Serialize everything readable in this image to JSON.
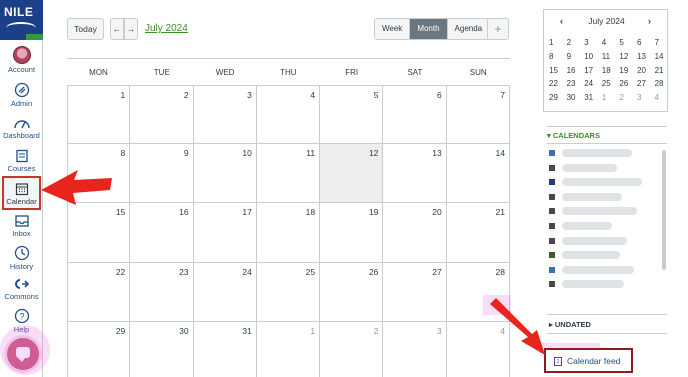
{
  "brand": {
    "logo_text": "NILE"
  },
  "global_nav": [
    {
      "key": "account",
      "label": "Account"
    },
    {
      "key": "admin",
      "label": "Admin"
    },
    {
      "key": "dashboard",
      "label": "Dashboard"
    },
    {
      "key": "courses",
      "label": "Courses"
    },
    {
      "key": "calendar",
      "label": "Calendar"
    },
    {
      "key": "inbox",
      "label": "Inbox"
    },
    {
      "key": "history",
      "label": "History"
    },
    {
      "key": "commons",
      "label": "Commons"
    },
    {
      "key": "help",
      "label": "Help"
    }
  ],
  "header": {
    "today_label": "Today",
    "prev_label": "←",
    "next_label": "→",
    "month_title": "July 2024",
    "views": [
      "Week",
      "Month",
      "Agenda"
    ],
    "active_view": "Month",
    "add_label": "+"
  },
  "calendar": {
    "weekdays": [
      "MON",
      "TUE",
      "WED",
      "THU",
      "FRI",
      "SAT",
      "SUN"
    ],
    "weeks": [
      [
        {
          "d": "1"
        },
        {
          "d": "2"
        },
        {
          "d": "3"
        },
        {
          "d": "4"
        },
        {
          "d": "5"
        },
        {
          "d": "6"
        },
        {
          "d": "7"
        }
      ],
      [
        {
          "d": "8"
        },
        {
          "d": "9"
        },
        {
          "d": "10"
        },
        {
          "d": "11"
        },
        {
          "d": "12",
          "today": true
        },
        {
          "d": "13"
        },
        {
          "d": "14"
        }
      ],
      [
        {
          "d": "15"
        },
        {
          "d": "16"
        },
        {
          "d": "17"
        },
        {
          "d": "18"
        },
        {
          "d": "19"
        },
        {
          "d": "20"
        },
        {
          "d": "21"
        }
      ],
      [
        {
          "d": "22"
        },
        {
          "d": "23"
        },
        {
          "d": "24"
        },
        {
          "d": "25"
        },
        {
          "d": "26"
        },
        {
          "d": "27"
        },
        {
          "d": "28"
        }
      ],
      [
        {
          "d": "29"
        },
        {
          "d": "30"
        },
        {
          "d": "31"
        },
        {
          "d": "1",
          "other": true
        },
        {
          "d": "2",
          "other": true
        },
        {
          "d": "3",
          "other": true
        },
        {
          "d": "4",
          "other": true
        }
      ]
    ]
  },
  "mini_calendar": {
    "title": "July 2024",
    "prev": "‹",
    "next": "›",
    "rows": [
      [
        {
          "d": "1"
        },
        {
          "d": "2"
        },
        {
          "d": "3"
        },
        {
          "d": "4"
        },
        {
          "d": "5"
        },
        {
          "d": "6"
        },
        {
          "d": "7"
        }
      ],
      [
        {
          "d": "8"
        },
        {
          "d": "9"
        },
        {
          "d": "10"
        },
        {
          "d": "11"
        },
        {
          "d": "12"
        },
        {
          "d": "13"
        },
        {
          "d": "14"
        }
      ],
      [
        {
          "d": "15"
        },
        {
          "d": "16"
        },
        {
          "d": "17"
        },
        {
          "d": "18"
        },
        {
          "d": "19"
        },
        {
          "d": "20"
        },
        {
          "d": "21"
        }
      ],
      [
        {
          "d": "22"
        },
        {
          "d": "23"
        },
        {
          "d": "24"
        },
        {
          "d": "25"
        },
        {
          "d": "26"
        },
        {
          "d": "27"
        },
        {
          "d": "28"
        }
      ],
      [
        {
          "d": "29"
        },
        {
          "d": "30"
        },
        {
          "d": "31"
        },
        {
          "d": "1",
          "other": true
        },
        {
          "d": "2",
          "other": true
        },
        {
          "d": "3",
          "other": true
        },
        {
          "d": "4",
          "other": true
        }
      ]
    ]
  },
  "sidebar": {
    "calendars_title": "CALENDARS",
    "calendar_colors": [
      "#3b6fb6",
      "#4a4a4a",
      "#1f3f7a",
      "#4a4a4a",
      "#4a4a4a",
      "#4a4a4a",
      "#4a4a4a",
      "#3d5a2a",
      "#3b6fb6",
      "#4a4a4a"
    ],
    "undated_title": "UNDATED",
    "feed_label": "Calendar feed"
  },
  "colors": {
    "accent_green": "#3a8f24",
    "brand_blue": "#1c3f8a",
    "arrow_red": "#e8251c"
  }
}
